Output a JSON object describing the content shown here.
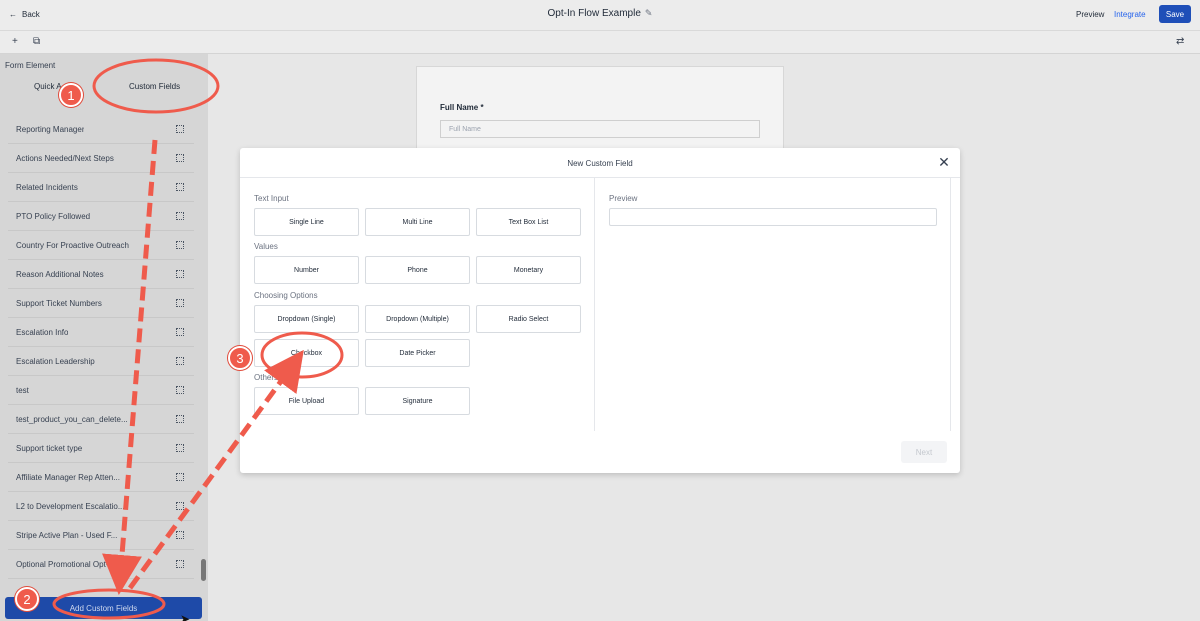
{
  "header": {
    "back_label": "Back",
    "title": "Opt-In Flow Example",
    "preview_label": "Preview",
    "integrate_label": "Integrate",
    "save_label": "Save"
  },
  "sidebar": {
    "section_label": "Form Element",
    "tabs": [
      {
        "label": "Quick A"
      },
      {
        "label": "Custom Fields"
      }
    ],
    "items": [
      {
        "label": "Reporting Manager"
      },
      {
        "label": "Actions Needed/Next Steps"
      },
      {
        "label": "Related Incidents"
      },
      {
        "label": "PTO Policy Followed"
      },
      {
        "label": "Country For Proactive Outreach"
      },
      {
        "label": "Reason Additional Notes"
      },
      {
        "label": "Support Ticket Numbers"
      },
      {
        "label": "Escalation Info"
      },
      {
        "label": "Escalation Leadership"
      },
      {
        "label": "test"
      },
      {
        "label": "test_product_you_can_delete..."
      },
      {
        "label": "Support ticket type"
      },
      {
        "label": "Affiliate Manager Rep Atten..."
      },
      {
        "label": "L2 to Development Escalatio..."
      },
      {
        "label": "Stripe Active Plan - Used F..."
      },
      {
        "label": "Optional Promotional Opt-In"
      }
    ],
    "add_button_label": "Add Custom Fields"
  },
  "canvas": {
    "field_label": "Full Name *",
    "field_placeholder": "Full Name"
  },
  "modal": {
    "title": "New Custom Field",
    "sections": {
      "text_input": "Text Input",
      "values": "Values",
      "choosing_options": "Choosing Options",
      "others": "Others"
    },
    "options": {
      "single_line": "Single Line",
      "multi_line": "Multi Line",
      "text_box_list": "Text Box List",
      "number": "Number",
      "phone": "Phone",
      "monetary": "Monetary",
      "dropdown_single": "Dropdown (Single)",
      "dropdown_multiple": "Dropdown (Multiple)",
      "radio_select": "Radio Select",
      "checkbox": "Checkbox",
      "date_picker": "Date Picker",
      "file_upload": "File Upload",
      "signature": "Signature"
    },
    "preview_label": "Preview",
    "next_label": "Next"
  },
  "annotations": {
    "badge1": "1",
    "badge2": "2",
    "badge3": "3",
    "color": "#ef5b4c"
  },
  "colors": {
    "primary": "#1f4fb8",
    "link": "#2563eb",
    "annotation": "#ef5b4c"
  }
}
